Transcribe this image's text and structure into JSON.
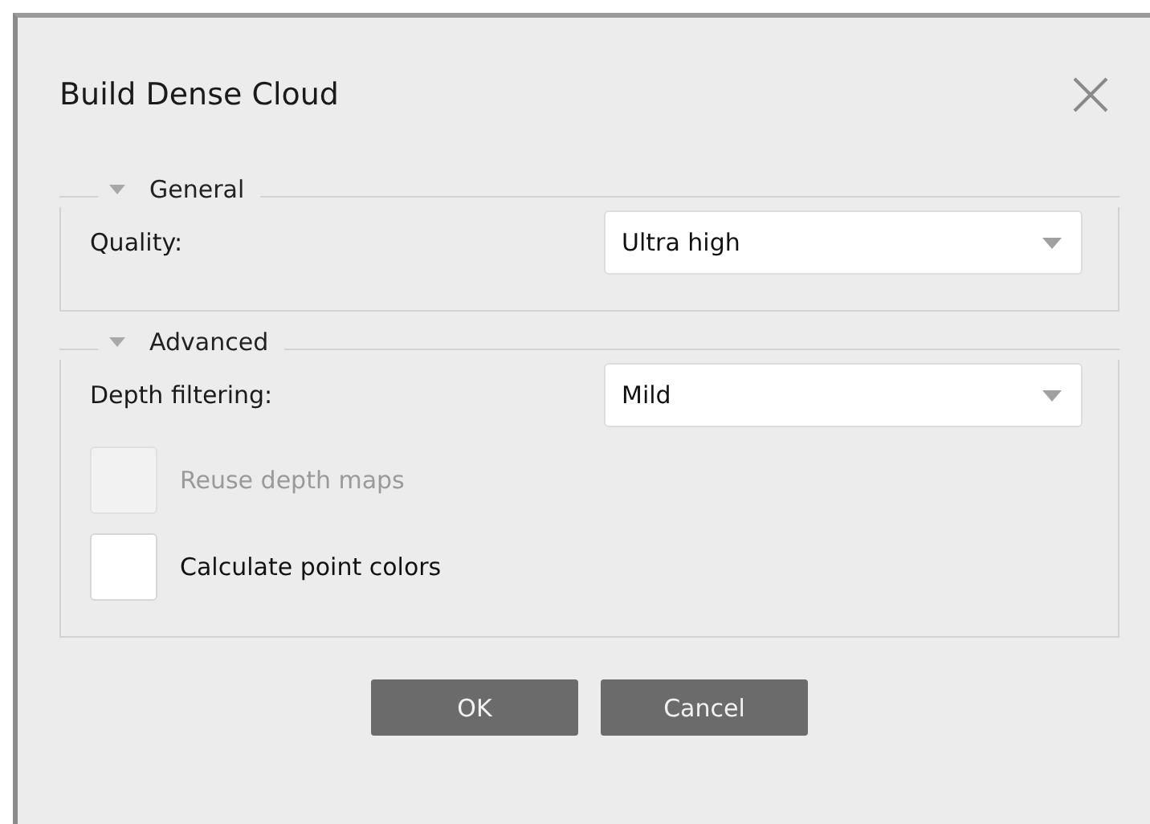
{
  "window": {
    "title": "Build Dense Cloud"
  },
  "groups": [
    {
      "title": "General",
      "expanded": true,
      "rows": [
        {
          "kind": "combo",
          "label": "Quality:",
          "value": "Ultra high"
        }
      ]
    },
    {
      "title": "Advanced",
      "expanded": true,
      "rows": [
        {
          "kind": "combo",
          "label": "Depth filtering:",
          "value": "Mild"
        },
        {
          "kind": "checkbox",
          "label": "Reuse depth maps",
          "checked": false,
          "disabled": true
        },
        {
          "kind": "checkbox",
          "label": "Calculate point colors",
          "checked": false,
          "disabled": false
        }
      ]
    }
  ],
  "buttons": [
    "OK",
    "Cancel"
  ]
}
